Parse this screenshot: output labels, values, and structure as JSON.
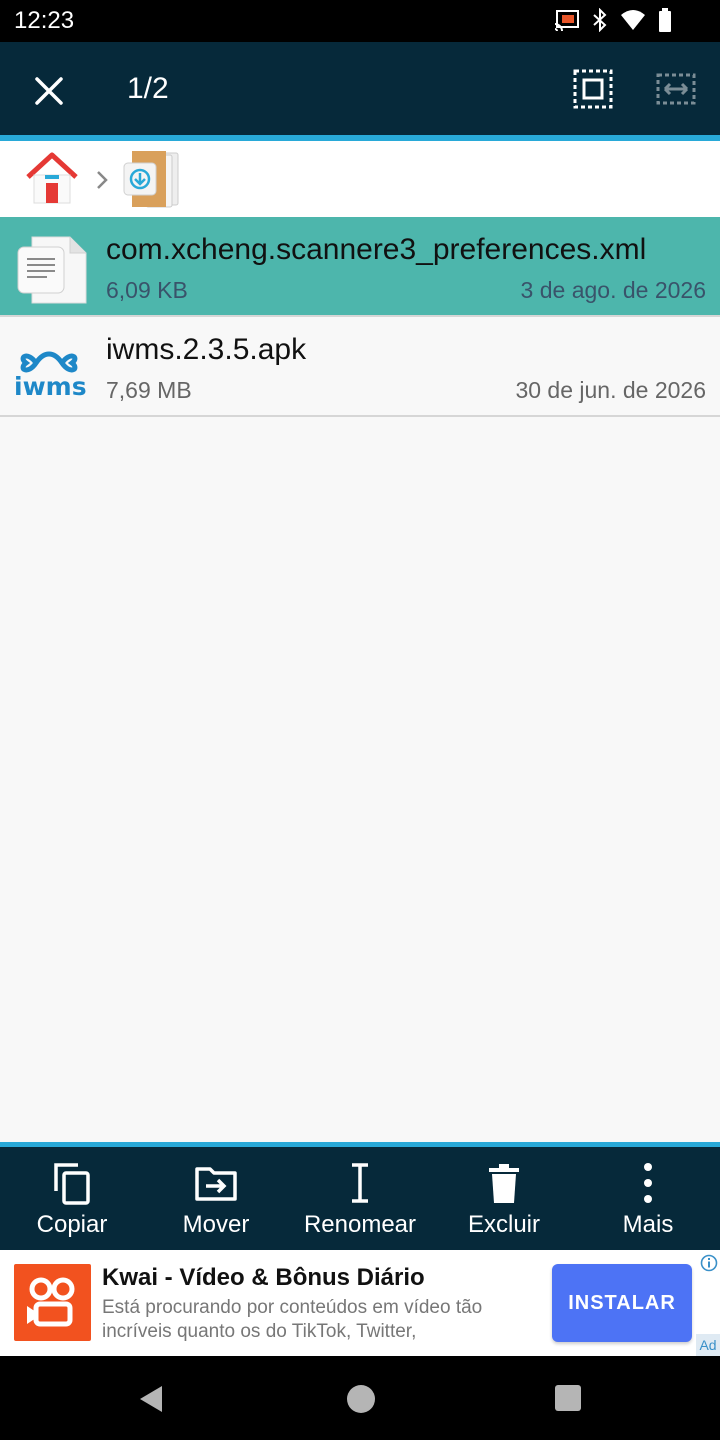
{
  "status_bar": {
    "time": "12:23",
    "icons": [
      "cast-icon",
      "bluetooth-icon",
      "wifi-icon",
      "battery-icon"
    ]
  },
  "top_bar": {
    "selection_count": "1/2",
    "close_icon": "close-icon",
    "select_all_icon": "select-all-icon",
    "select_range_icon": "select-range-icon"
  },
  "breadcrumb": {
    "items": [
      "home-folder-icon",
      "download-folder-icon"
    ]
  },
  "files": [
    {
      "name": "com.xcheng.scannere3_preferences.xml",
      "size": "6,09 KB",
      "date": "3 de ago. de 2026",
      "icon": "document-icon",
      "selected": true
    },
    {
      "name": "iwms.2.3.5.apk",
      "size": "7,69 MB",
      "date": "30 de jun. de 2026",
      "icon": "iwms-app-icon",
      "icon_text": "iwms",
      "selected": false
    }
  ],
  "actions": [
    {
      "label": "Copiar",
      "icon": "copy-icon"
    },
    {
      "label": "Mover",
      "icon": "move-icon"
    },
    {
      "label": "Renomear",
      "icon": "rename-icon"
    },
    {
      "label": "Excluir",
      "icon": "delete-icon"
    },
    {
      "label": "Mais",
      "icon": "more-icon"
    }
  ],
  "ad": {
    "title": "Kwai - Vídeo & Bônus Diário",
    "description": "Está procurando por conteúdos em vídeo tão incríveis quanto os do TikTok, Twitter,",
    "install_label": "INSTALAR",
    "badge": "Ad"
  },
  "colors": {
    "toolbar": "#06293a",
    "accent": "#28a9d8",
    "selected_row": "#4db6ac",
    "install_button": "#4d73f5",
    "ad_logo": "#f2521f"
  }
}
